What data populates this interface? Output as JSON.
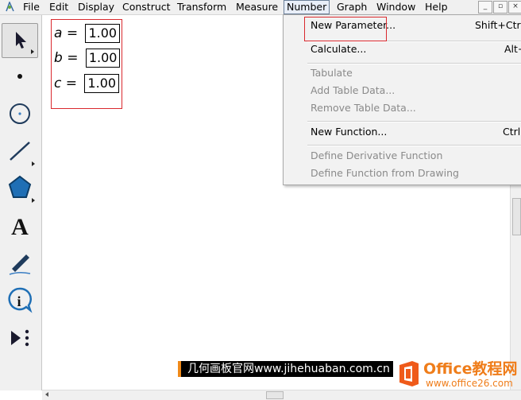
{
  "menubar": {
    "items": [
      "File",
      "Edit",
      "Display",
      "Construct",
      "Transform",
      "Measure",
      "Number",
      "Graph",
      "Window",
      "Help"
    ],
    "active": "Number",
    "window_buttons": {
      "minimize": "_",
      "restore": "▫",
      "close": "×"
    }
  },
  "toolbar": {
    "tools": [
      "arrow-tool",
      "point-tool",
      "compass-tool",
      "straightedge-tool",
      "polygon-tool",
      "text-tool",
      "marker-tool",
      "information-tool",
      "custom-tool"
    ],
    "text_tool_glyph": "A",
    "info_tool_glyph": "i"
  },
  "parameters": [
    {
      "name": "a",
      "equals": "=",
      "value": "1.00"
    },
    {
      "name": "b",
      "equals": "=",
      "value": "1.00"
    },
    {
      "name": "c",
      "equals": "=",
      "value": "1.00"
    }
  ],
  "number_menu": {
    "items": [
      {
        "label": "New Parameter...",
        "shortcut": "Shift+Ctrl+",
        "enabled": true
      },
      {
        "label": "Calculate...",
        "shortcut": "Alt+",
        "enabled": true
      },
      {
        "label": "Tabulate",
        "shortcut": "",
        "enabled": false
      },
      {
        "label": "Add Table Data...",
        "shortcut": "",
        "enabled": false
      },
      {
        "label": "Remove Table Data...",
        "shortcut": "",
        "enabled": false
      },
      {
        "label": "New Function...",
        "shortcut": "Ctrl+",
        "enabled": true
      },
      {
        "label": "Define Derivative Function",
        "shortcut": "",
        "enabled": false
      },
      {
        "label": "Define Function from Drawing",
        "shortcut": "",
        "enabled": false
      }
    ]
  },
  "watermark": {
    "left_text": "几何画板官网www.jihehuaban.com.cn",
    "brand": "Office教程网",
    "url": "www.office26.com"
  },
  "colors": {
    "highlight_red": "#d9292e",
    "polygon_blue": "#1f6fb5",
    "watermark_orange": "#ef7d1a"
  }
}
